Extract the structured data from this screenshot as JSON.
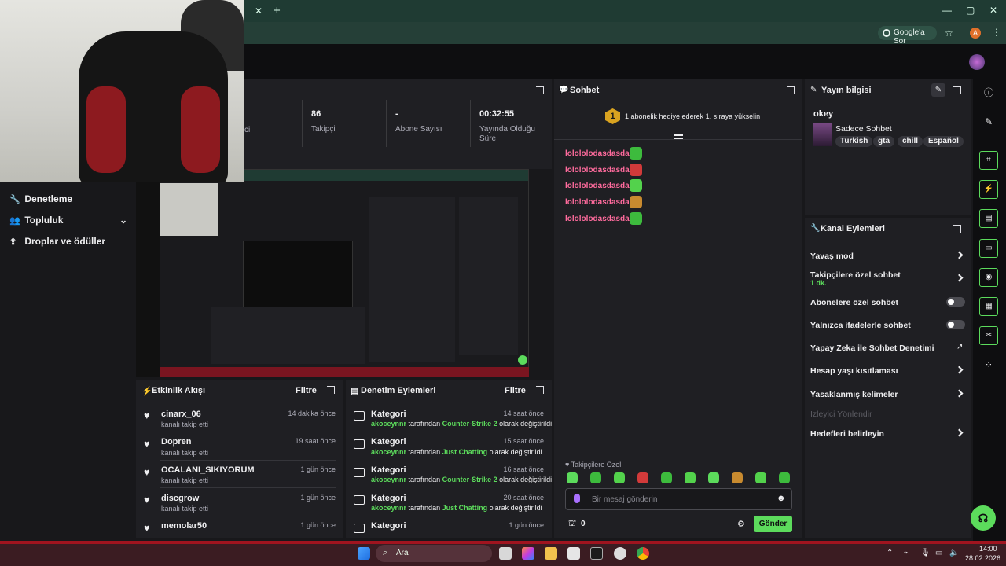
{
  "browser": {
    "tab_close": "✕",
    "new_tab": "+",
    "google_sor": "Google'a Sor",
    "profile_letter": "A",
    "window": {
      "min": "—",
      "max": "▢",
      "close": "✕"
    }
  },
  "left_nav": {
    "items": [
      {
        "label": "Denetleme",
        "icon": "wrench-icon"
      },
      {
        "label": "Topluluk",
        "icon": "community-icon"
      },
      {
        "label": "Droplar ve ödüller",
        "icon": "drops-icon"
      }
    ]
  },
  "stats": {
    "partial_label": "ci",
    "items": [
      {
        "value": "86",
        "label": "Takipçi"
      },
      {
        "value": "-",
        "label": "Abone Sayısı"
      },
      {
        "value": "00:32:55",
        "label": "Yayında Olduğu Süre"
      }
    ]
  },
  "activity": {
    "title": "Etkinlik Akışı",
    "filter": "Filtre",
    "items": [
      {
        "name": "cinarx_06",
        "sub": "kanalı takip etti",
        "time": "14 dakika önce"
      },
      {
        "name": "Dopren",
        "sub": "kanalı takip etti",
        "time": "19 saat önce"
      },
      {
        "name": "OCALANI_SIKIYORUM",
        "sub": "kanalı takip etti",
        "time": "1 gün önce"
      },
      {
        "name": "discgrow",
        "sub": "kanalı takip etti",
        "time": "1 gün önce"
      },
      {
        "name": "memolar50",
        "sub": "kanalı takip etti",
        "time": "1 gün önce"
      }
    ]
  },
  "moderation": {
    "title": "Denetim Eylemleri",
    "filter": "Filtre",
    "items": [
      {
        "title": "Kategori",
        "user": "akoceynnr",
        "mid": "tarafından",
        "game": "Counter-Strike 2",
        "end": "olarak değiştirildi",
        "time": "14 saat önce"
      },
      {
        "title": "Kategori",
        "user": "akoceynnr",
        "mid": "tarafından",
        "game": "Just Chatting",
        "end": "olarak değiştirildi",
        "time": "15 saat önce"
      },
      {
        "title": "Kategori",
        "user": "akoceynnr",
        "mid": "tarafından",
        "game": "Counter-Strike 2",
        "end": "olarak değiştirildi",
        "time": "16 saat önce"
      },
      {
        "title": "Kategori",
        "user": "akoceynnr",
        "mid": "tarafından",
        "game": "Just Chatting",
        "end": "olarak değiştirildi",
        "time": "20 saat önce"
      },
      {
        "title": "Kategori",
        "user": "",
        "mid": "",
        "game": "",
        "end": "",
        "time": "1 gün önce"
      }
    ]
  },
  "chat": {
    "title": "Sohbet",
    "rank": "1",
    "banner": "1 abonelik hediye ederek 1. sıraya yükselin",
    "messages": [
      {
        "user": "lolololodasdasdas:",
        "emote_color": "#3dbb3d"
      },
      {
        "user": "lolololodasdasdas:",
        "emote_color": "#d23a3a"
      },
      {
        "user": "lolololodasdasdas:",
        "emote_color": "#53d24c"
      },
      {
        "user": "lolololodasdasdas:",
        "emote_color": "#c88a2f"
      },
      {
        "user": "lolololodasdasdas:",
        "emote_color": "#3dbb3d"
      }
    ],
    "follower_mode": "Takipçilere Özel",
    "emotes": [
      "#5cdb5c",
      "#3dbb3d",
      "#53d24c",
      "#d23a3a",
      "#3dbb3d",
      "#53d24c",
      "#5cdb5c",
      "#c88a2f",
      "#53d24c",
      "#3dbb3d"
    ],
    "input_placeholder": "Bir mesaj gönderin",
    "points": "0",
    "send": "Gönder"
  },
  "stream_info": {
    "title": "Yayın bilgisi",
    "stream_title": "okey",
    "category": "Sadece Sohbet",
    "tags": [
      "Turkish",
      "gta",
      "chill",
      "Español"
    ]
  },
  "channel_actions": {
    "title": "Kanal Eylemleri",
    "items": [
      {
        "label": "Yavaş mod",
        "type": "chevron"
      },
      {
        "label": "Takipçilere özel sohbet",
        "sub": "1 dk.",
        "type": "chevron"
      },
      {
        "label": "Abonelere özel sohbet",
        "type": "toggle"
      },
      {
        "label": "Yalnızca ifadelerle sohbet",
        "type": "toggle"
      },
      {
        "label": "Yapay Zeka ile Sohbet Denetimi",
        "type": "external"
      },
      {
        "label": "Hesap yaşı kısıtlaması",
        "type": "chevron"
      },
      {
        "label": "Yasaklanmış kelimeler",
        "type": "chevron"
      },
      {
        "label": "İzleyici Yönlendir",
        "type": "disabled"
      },
      {
        "label": "Hedefleri belirleyin",
        "type": "chevron"
      }
    ]
  },
  "taskbar": {
    "search": "Ara",
    "time": "14:00",
    "date": "28.02.2026"
  },
  "colors": {
    "accent": "#5cdb5c",
    "chat_user": "#ff6b9d",
    "panel": "#1f1f23",
    "bg": "#18181b"
  }
}
